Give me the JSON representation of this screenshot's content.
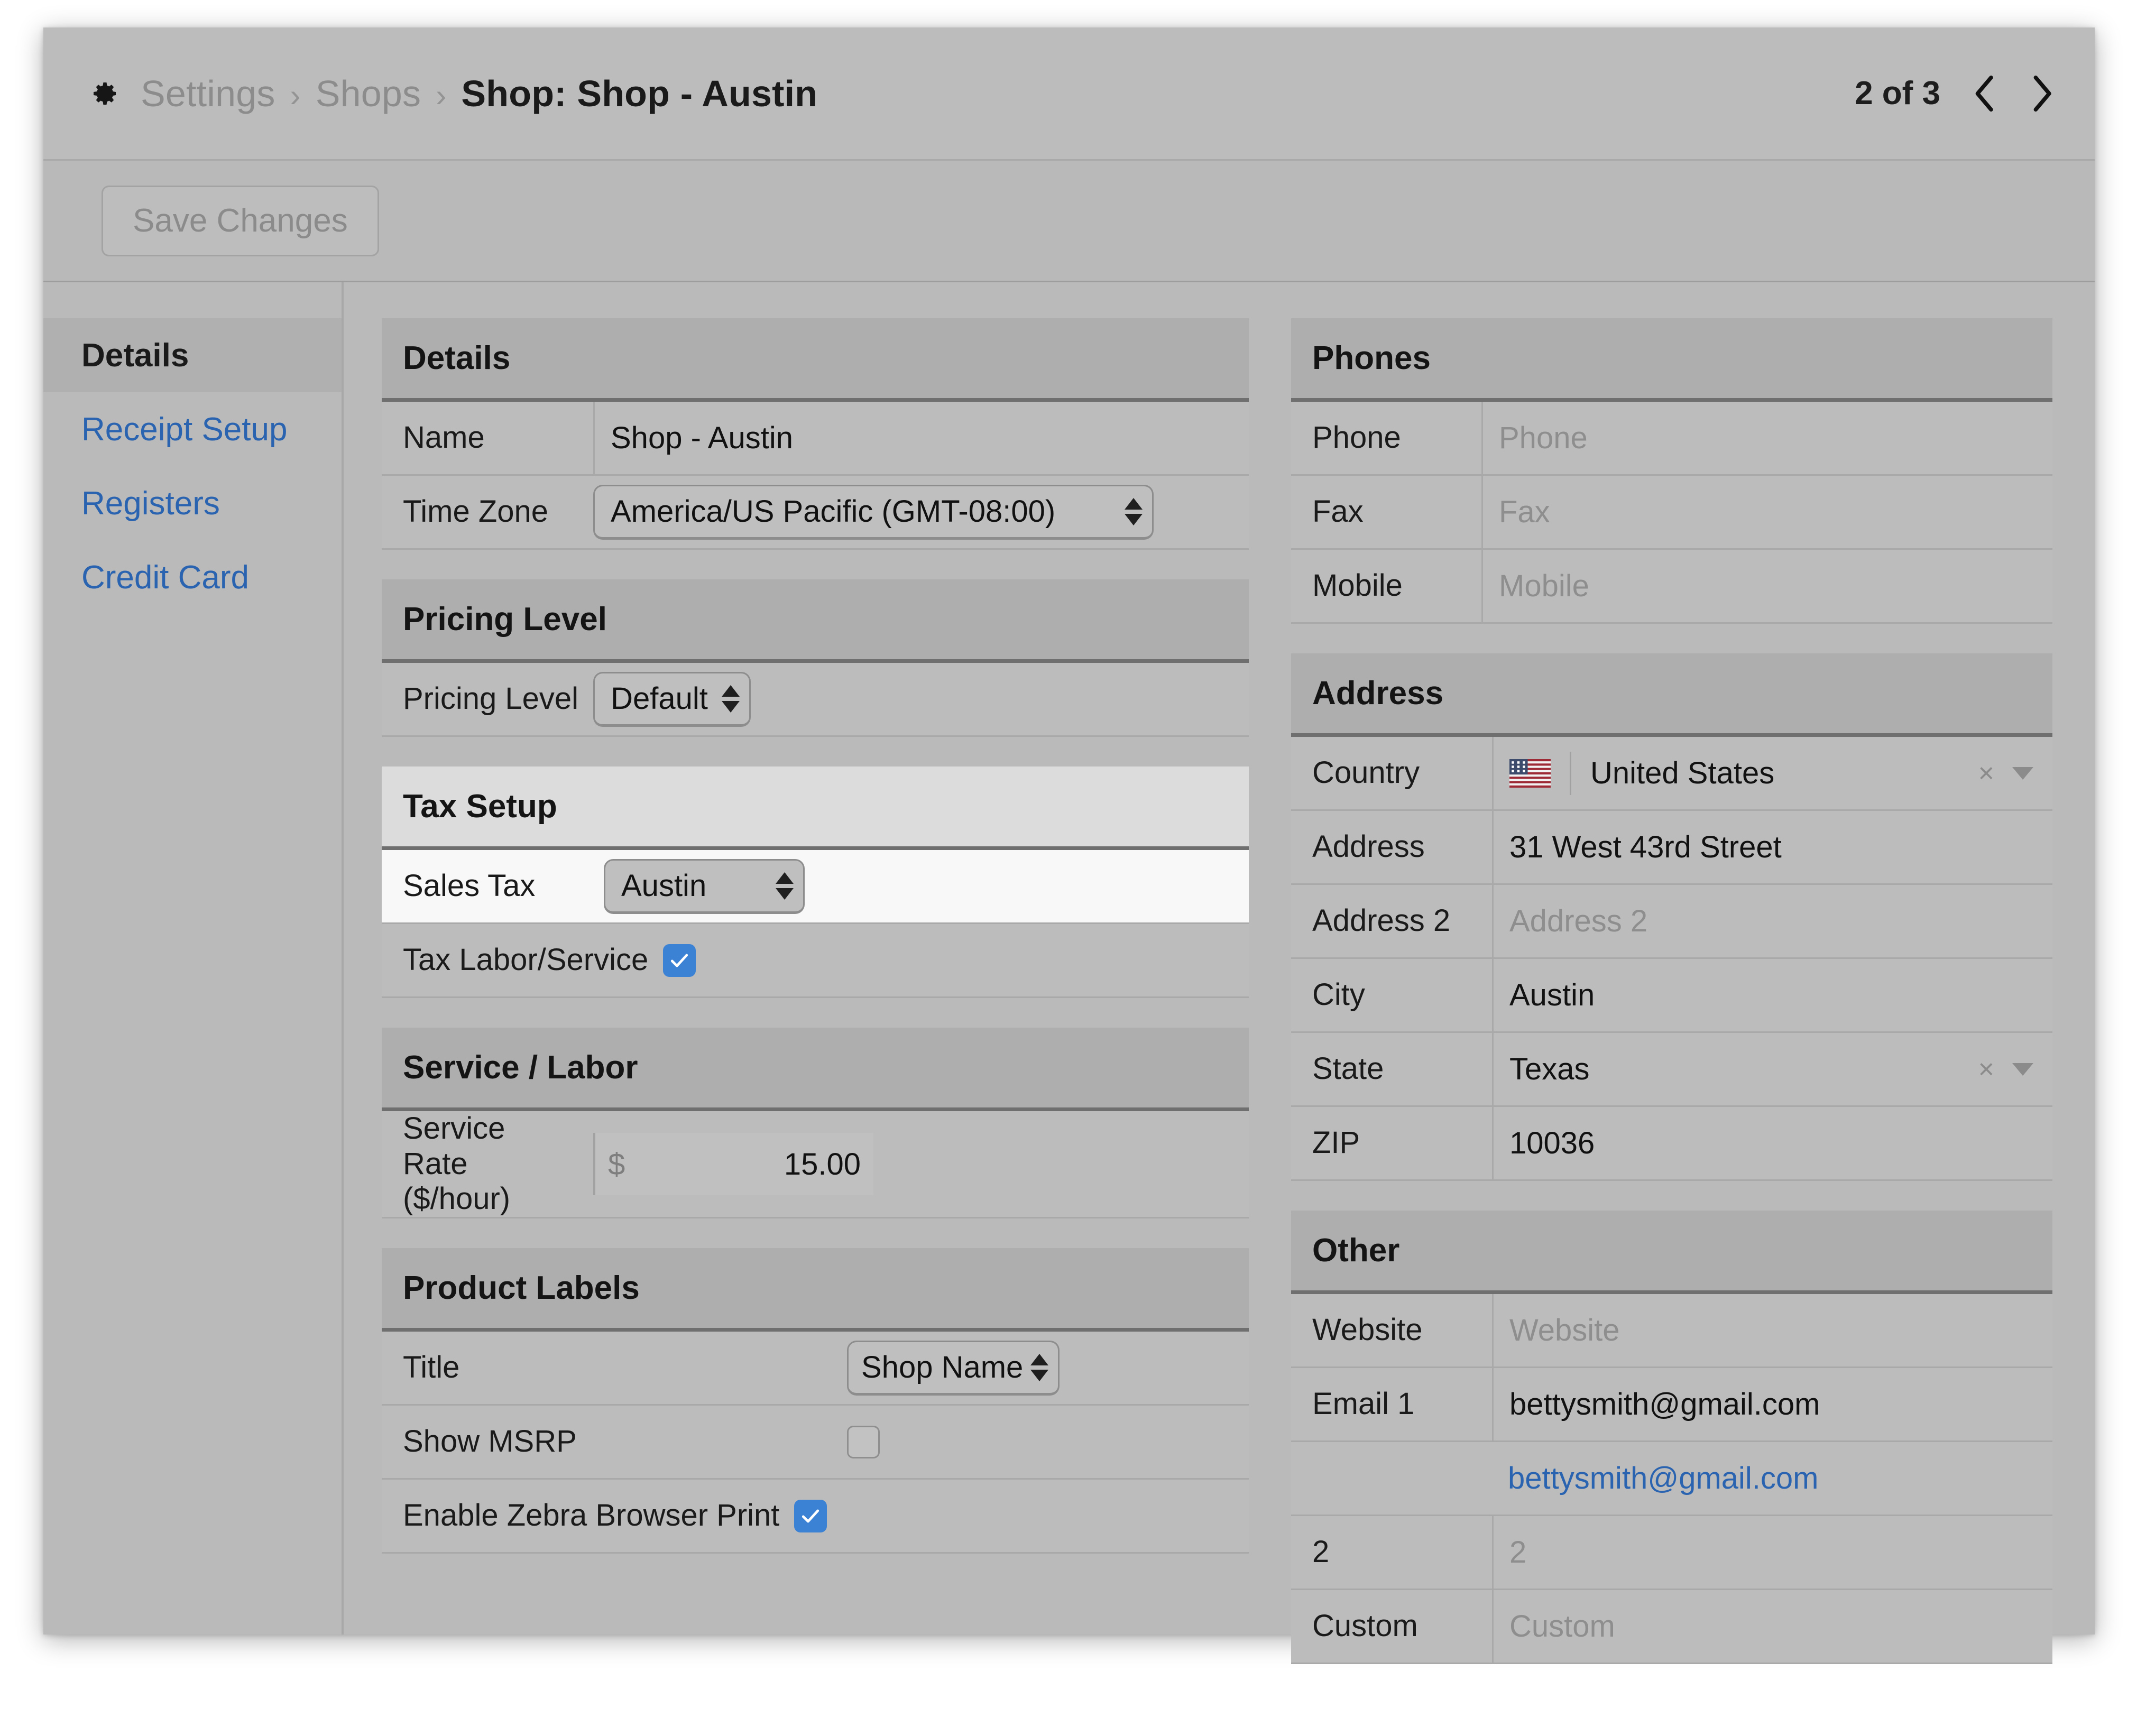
{
  "header": {
    "gear_icon": "gear-icon",
    "breadcrumb": [
      "Settings",
      "Shops",
      "Shop: Shop - Austin"
    ],
    "separator": "›",
    "pager": {
      "count": "2 of 3",
      "prev_icon": "chevron-left-icon",
      "next_icon": "chevron-right-icon"
    }
  },
  "toolbar": {
    "save_label": "Save Changes"
  },
  "sidebar": {
    "items": [
      {
        "label": "Details",
        "active": true
      },
      {
        "label": "Receipt Setup",
        "active": false
      },
      {
        "label": "Registers",
        "active": false
      },
      {
        "label": "Credit Card",
        "active": false
      }
    ]
  },
  "panels": {
    "details": {
      "title": "Details",
      "name_label": "Name",
      "name_value": "Shop - Austin",
      "timezone_label": "Time Zone",
      "timezone_value": "America/US Pacific (GMT-08:00)"
    },
    "pricing": {
      "title": "Pricing Level",
      "level_label": "Pricing Level",
      "level_value": "Default"
    },
    "tax": {
      "title": "Tax Setup",
      "sales_tax_label": "Sales Tax",
      "sales_tax_value": "Austin",
      "tax_labor_label": "Tax Labor/Service",
      "tax_labor_checked": "checked"
    },
    "service": {
      "title": "Service / Labor",
      "rate_label_line1": "Service Rate",
      "rate_label_line2": "($/hour)",
      "currency": "$",
      "rate_value": "15.00"
    },
    "product_labels": {
      "title": "Product Labels",
      "title_label": "Title",
      "title_value": "Shop Name",
      "msrp_label": "Show MSRP",
      "msrp_checked": "unchecked",
      "zebra_label": "Enable Zebra Browser Print",
      "zebra_checked": "checked"
    },
    "phones": {
      "title": "Phones",
      "rows": [
        {
          "label": "Phone",
          "value": "Phone",
          "placeholder": true
        },
        {
          "label": "Fax",
          "value": "Fax",
          "placeholder": true
        },
        {
          "label": "Mobile",
          "value": "Mobile",
          "placeholder": true
        }
      ]
    },
    "address": {
      "title": "Address",
      "country_label": "Country",
      "country_value": "United States",
      "country_flag": "us-flag-icon",
      "clear_glyph": "×",
      "rows": [
        {
          "label": "Address",
          "value": "31 West 43rd Street",
          "placeholder": false
        },
        {
          "label": "Address 2",
          "value": "Address 2",
          "placeholder": true
        },
        {
          "label": "City",
          "value": "Austin",
          "placeholder": false
        }
      ],
      "state_label": "State",
      "state_value": "Texas",
      "zip_label": "ZIP",
      "zip_value": "10036"
    },
    "other": {
      "title": "Other",
      "website_label": "Website",
      "website_value": "Website",
      "email_label": "Email 1",
      "email_value": "bettysmith@gmail.com",
      "email_link": "bettysmith@gmail.com",
      "two_label": "2",
      "two_value": "2",
      "custom_label": "Custom",
      "custom_value": "Custom"
    }
  },
  "colors": {
    "accent_blue": "#3b82d4",
    "link_blue": "#2a63b0",
    "panel_head": "#aeaeae",
    "panel_head_light": "#dcdcdc",
    "row_bg": "#bcbcbc",
    "row_highlight": "#f8f8f8",
    "window_bg": "#b7b7b7",
    "flag_navy": "#3c4a6b",
    "flag_red": "#9e2a35"
  }
}
